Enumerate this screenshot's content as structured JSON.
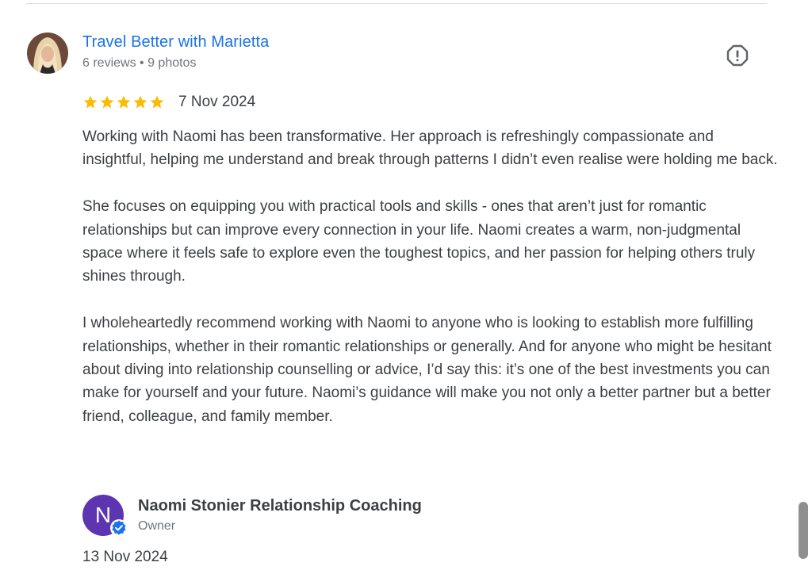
{
  "review": {
    "reviewer_name": "Travel Better with Marietta",
    "reviewer_meta": "6 reviews • 9 photos",
    "rating": 5,
    "rating_max": 5,
    "date": "7 Nov 2024",
    "paragraphs": [
      "Working with Naomi has been transformative. Her approach is refreshingly compassionate and insightful, helping me understand and break through patterns I didn’t even realise were holding me back.",
      "She focuses on equipping you with practical tools and skills - ones that aren’t just for romantic relationships but can improve every connection in your life. Naomi creates a warm, non-judgmental space where it feels safe to explore even the toughest topics, and her passion for helping others truly shines through.",
      "I wholeheartedly recommend working with Naomi to anyone who is looking to establish more fulfilling relationships, whether in their romantic relationships or generally. And for anyone who might be hesitant about diving into relationship counselling or advice, I’d say this: it’s one of the best investments you can make for yourself and your future. Naomi’s guidance will make you not only a better partner but a better friend, colleague, and family member."
    ]
  },
  "owner_response": {
    "avatar_letter": "N",
    "name": "Naomi Stonier Relationship Coaching",
    "role": "Owner",
    "date": "13 Nov 2024"
  },
  "icons": {
    "report": "report-flag-icon",
    "star": "star-icon",
    "verified": "verified-check-icon"
  },
  "colors": {
    "link": "#1a73e8",
    "star": "#fbbc04",
    "owner_avatar": "#5e35b1",
    "verified": "#1a73e8",
    "text": "#3c4043",
    "meta": "#70757a"
  }
}
